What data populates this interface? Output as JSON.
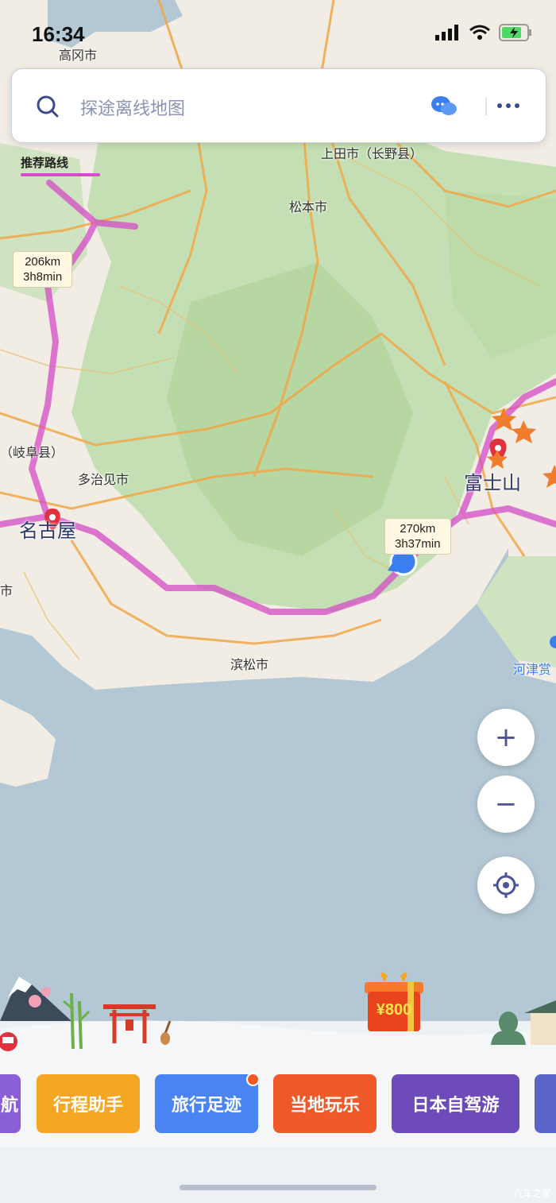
{
  "status_bar": {
    "time": "16:34"
  },
  "search": {
    "placeholder": "探途离线地图"
  },
  "route": {
    "label": "推荐路线",
    "route_color": "#d44cc7",
    "callouts": [
      {
        "distance": "206km",
        "duration": "3h8min"
      },
      {
        "distance": "270km",
        "duration": "3h37min"
      }
    ]
  },
  "map": {
    "labels": {
      "takaoka": "高冈市",
      "ueda": "上田市（长野县）",
      "matsumoto": "松本市",
      "gifu": "（岐阜县）",
      "tajimi": "多治见市",
      "hamamatsu": "滨松市",
      "kawazu": "河津赏",
      "shi_left": "市"
    },
    "big_labels": {
      "nagoya": "名古屋",
      "fuji": "富士山"
    },
    "colors": {
      "land": "#dfe9d6",
      "green": "#b8d8a8",
      "sea": "#b3c7d4",
      "road": "#f0a848"
    }
  },
  "controls": {
    "zoom_in": "+",
    "zoom_out": "−"
  },
  "promo": {
    "gift_amount": "¥800"
  },
  "cards": [
    {
      "label": "航",
      "color": "#8a5fd6"
    },
    {
      "label": "行程助手",
      "color": "#f5a623"
    },
    {
      "label": "旅行足迹",
      "color": "#4a84f2"
    },
    {
      "label": "当地玩乐",
      "color": "#f05a28"
    },
    {
      "label": "日本自驾游",
      "color": "#6d4bb8"
    }
  ],
  "watermark": "汽车之家"
}
